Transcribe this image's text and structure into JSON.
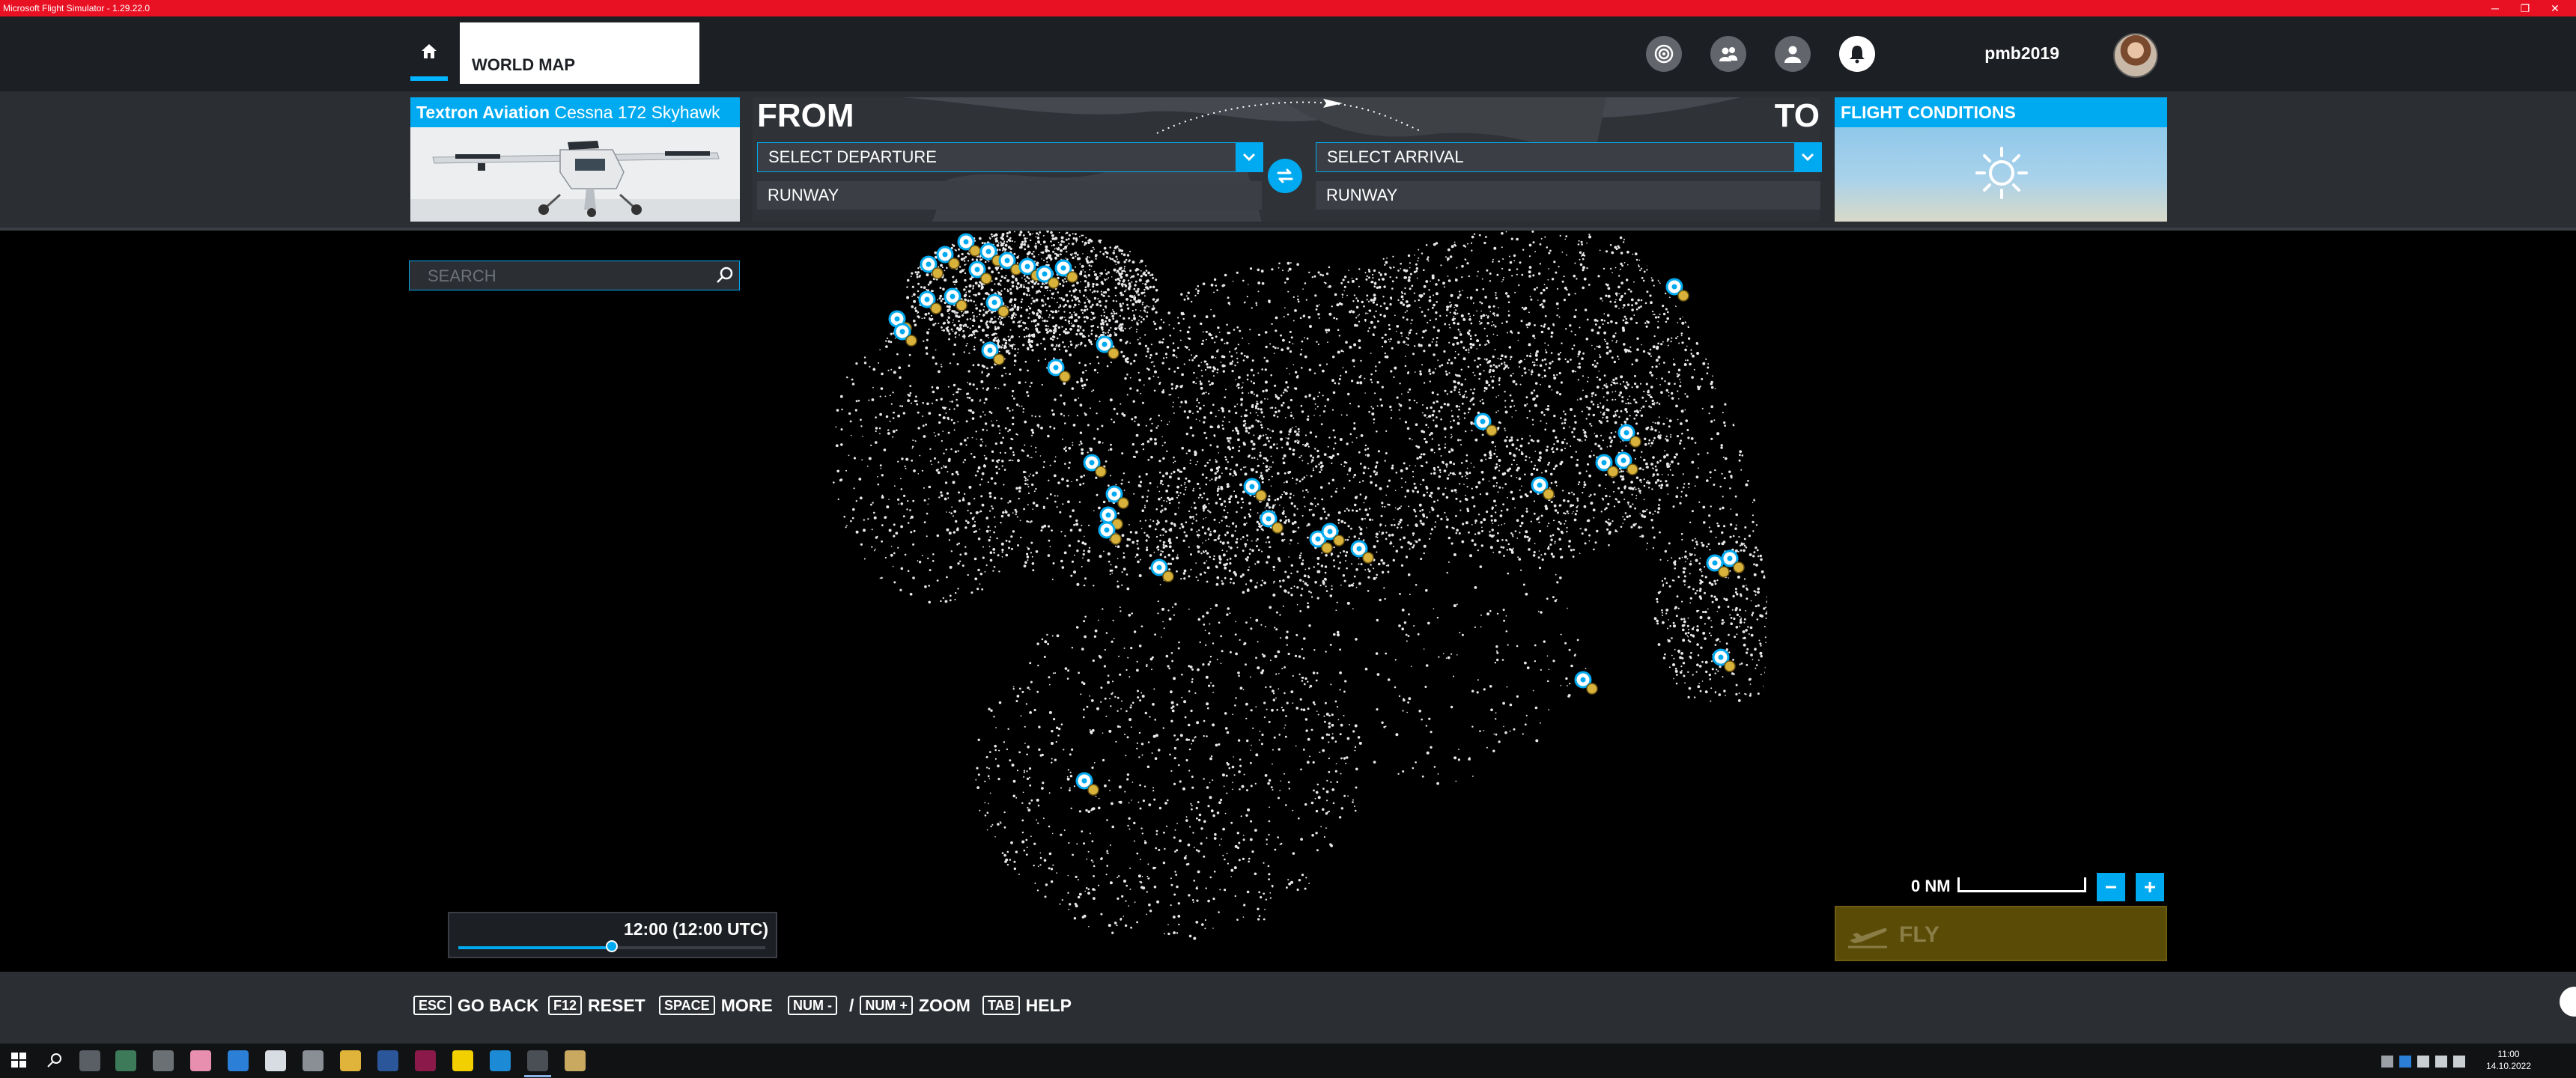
{
  "window": {
    "title": "Microsoft Flight Simulator - 1.29.22.0",
    "minimize_glyph": "─",
    "maximize_glyph": "❐",
    "close_glyph": "✕"
  },
  "nav": {
    "home_icon": "home-icon",
    "tab_label": "WORLD MAP",
    "icons": [
      "achievements-icon",
      "friends-icon",
      "profile-icon",
      "notifications-icon"
    ],
    "username": "pmb2019"
  },
  "aircraft": {
    "manufacturer": "Textron Aviation",
    "model": "Cessna 172 Skyhawk"
  },
  "route": {
    "from_label": "FROM",
    "to_label": "TO",
    "departure_placeholder": "SELECT DEPARTURE",
    "arrival_placeholder": "SELECT ARRIVAL",
    "departure_runway": "RUNWAY",
    "arrival_runway": "RUNWAY"
  },
  "conditions": {
    "title": "FLIGHT CONDITIONS",
    "weather_icon": "sun-icon"
  },
  "search": {
    "placeholder": "SEARCH"
  },
  "time": {
    "label": "12:00 (12:00 UTC)",
    "slider_fraction": 0.5
  },
  "map": {
    "scale_label": "0 NM",
    "zoom_out_glyph": "minus",
    "zoom_in_glyph": "plus"
  },
  "fly": {
    "label": "FLY"
  },
  "hints": [
    {
      "key": "ESC",
      "label": "GO BACK"
    },
    {
      "key": "F12",
      "label": "RESET"
    },
    {
      "key": "SPACE",
      "label": "MORE"
    },
    {
      "key": "NUM -",
      "key2": "NUM +",
      "label": "ZOOM"
    },
    {
      "key": "TAB",
      "label": "HELP"
    }
  ],
  "taskbar": {
    "time": "11:00",
    "date": "14.10.2022"
  },
  "colors": {
    "accent": "#00aaf0",
    "titlebar": "#e81123",
    "fly_disabled": "#5a4b07"
  }
}
